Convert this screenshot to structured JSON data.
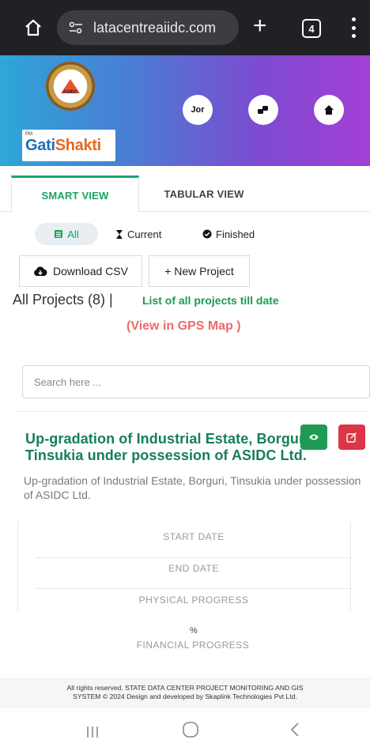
{
  "browser": {
    "url": "latacentreaiidc.com",
    "tab_count": "4",
    "plus": "+"
  },
  "header": {
    "logo_text": "ASIDC",
    "brand_small": "PM",
    "brand_gati": "Gati",
    "brand_shakti": "Shakti",
    "user_button": "Jor"
  },
  "tabs": [
    "SMART VIEW",
    "TABULAR VIEW"
  ],
  "filters": [
    "All",
    "Current",
    "Finished"
  ],
  "actions": {
    "download_csv": "Download CSV",
    "new_project": "+ New Project"
  },
  "summary": {
    "all_projects": "All Projects (8) |",
    "list_all": "List of all projects till date",
    "gps_map": "(View in GPS Map )"
  },
  "search": {
    "placeholder": "Search here ..."
  },
  "project": {
    "title": "Up-gradation of Industrial Estate, Borguri, Tinsukia under possession of ASIDC Ltd.",
    "description": "Up-gradation of Industrial Estate, Borguri, Tinsukia under possession of ASIDC Ltd.",
    "labels": {
      "start_date": "START DATE",
      "end_date": "END DATE",
      "physical_progress": "PHYSICAL PROGRESS",
      "percent": "%",
      "financial_progress": "FINANCIAL PROGRESS"
    }
  },
  "footer": {
    "line1": "All rights reserved. STATE DATA CENTER PROJECT MONITORING AND GIS",
    "line2": "SYSTEM © 2024   Design and developed by Skaplink Technologies Pvt Ltd."
  },
  "colors": {
    "accent_green": "#18a566",
    "title_green": "#167f56",
    "gps_red": "#ef6a6a",
    "edit_red": "#dc3545",
    "view_green": "#1f9a55"
  }
}
